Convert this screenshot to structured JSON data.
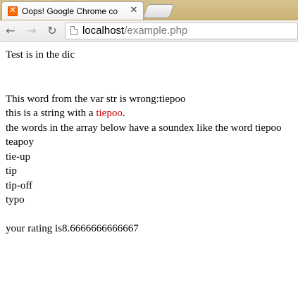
{
  "browser": {
    "tab_title": "Oops! Google Chrome co",
    "url_host": "localhost",
    "url_path": "/example.php"
  },
  "page": {
    "line1": "Test is in the dic",
    "line2": "This word from the var str is wrong:tiepoo",
    "line3_prefix": "this is a string with a ",
    "line3_highlight": "tiepoo",
    "line3_suffix": ".",
    "line4": "the words in the array below have a soundex like the word tiepoo",
    "words": [
      "teapoy",
      "tie-up",
      "tip",
      "tip-off",
      "typo"
    ],
    "rating": "your rating is8.6666666666667"
  },
  "colors": {
    "highlight": "#cc0000"
  }
}
